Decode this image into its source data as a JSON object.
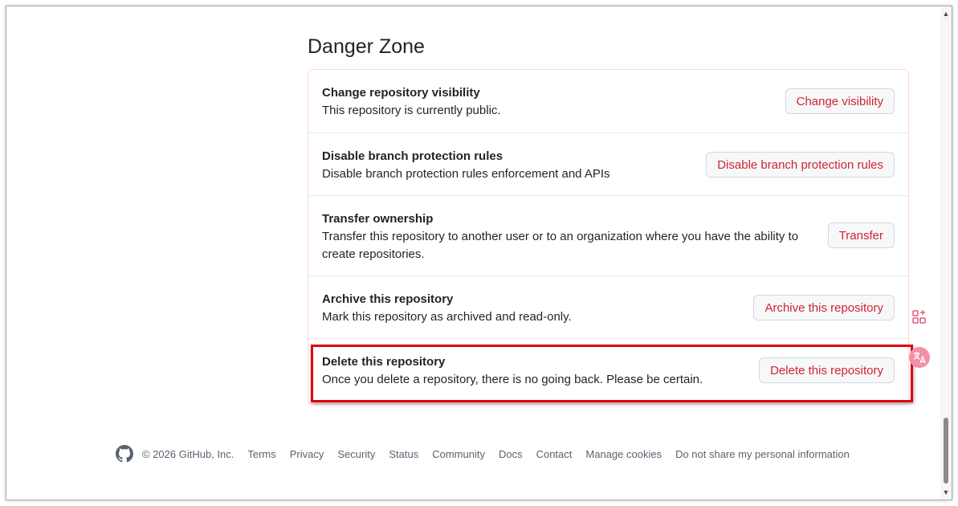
{
  "danger_zone": {
    "title": "Danger Zone",
    "rows": [
      {
        "title": "Change repository visibility",
        "description": "This repository is currently public.",
        "button": "Change visibility"
      },
      {
        "title": "Disable branch protection rules",
        "description": "Disable branch protection rules enforcement and APIs",
        "button": "Disable branch protection rules"
      },
      {
        "title": "Transfer ownership",
        "description": "Transfer this repository to another user or to an organization where you have the ability to create repositories.",
        "button": "Transfer"
      },
      {
        "title": "Archive this repository",
        "description": "Mark this repository as archived and read-only.",
        "button": "Archive this repository"
      },
      {
        "title": "Delete this repository",
        "description": "Once you delete a repository, there is no going back. Please be certain.",
        "button": "Delete this repository"
      }
    ]
  },
  "footer": {
    "copyright": "© 2026 GitHub, Inc.",
    "links": [
      "Terms",
      "Privacy",
      "Security",
      "Status",
      "Community",
      "Docs",
      "Contact",
      "Manage cookies",
      "Do not share my personal information"
    ]
  },
  "colors": {
    "danger_text": "#d1242f",
    "danger_border": "#ffd8dc",
    "highlight": "#e0000a",
    "button_bg": "#f6f8fa"
  },
  "icons": {
    "footer_logo": "github-logo-icon",
    "side_top": "apps-add-icon",
    "side_bottom": "translate-icon"
  }
}
